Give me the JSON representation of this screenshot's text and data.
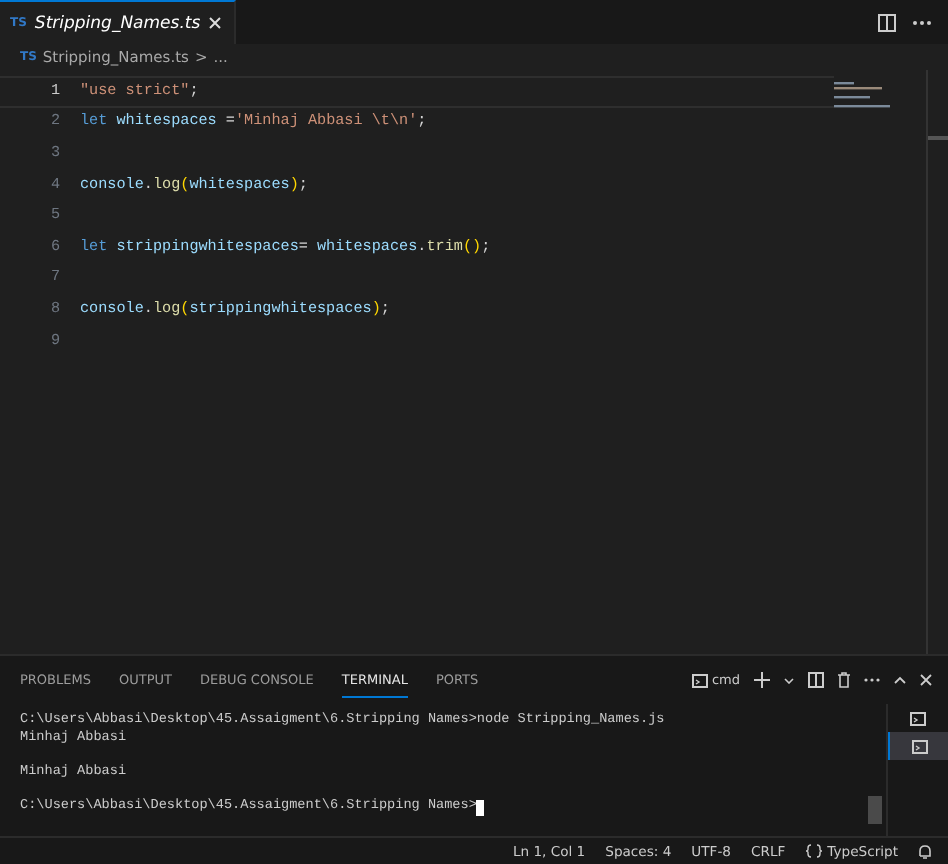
{
  "tab": {
    "icon": "TS",
    "title": "Stripping_Names.ts",
    "selected": true
  },
  "breadcrumb": {
    "icon": "TS",
    "file": "Stripping_Names.ts",
    "separator": ">",
    "more": "..."
  },
  "editor": {
    "lines": [
      {
        "number": "1",
        "current": true,
        "tokens": [
          {
            "text": "\"use strict\"",
            "kind": "string"
          },
          {
            "text": ";",
            "kind": "plain"
          }
        ]
      },
      {
        "number": "2",
        "tokens": [
          {
            "text": "let ",
            "kind": "keyword"
          },
          {
            "text": "whitespaces",
            "kind": "variable"
          },
          {
            "text": " =",
            "kind": "plain"
          },
          {
            "text": "'Minhaj Abbasi \\t\\n'",
            "kind": "string"
          },
          {
            "text": ";",
            "kind": "plain"
          }
        ]
      },
      {
        "number": "3"
      },
      {
        "number": "4",
        "tokens": [
          {
            "text": "console",
            "kind": "variable"
          },
          {
            "text": ".",
            "kind": "plain"
          },
          {
            "text": "log",
            "kind": "function"
          },
          {
            "text": "(",
            "kind": "bracket"
          },
          {
            "text": "whitespaces",
            "kind": "variable"
          },
          {
            "text": ")",
            "kind": "bracket"
          },
          {
            "text": ";",
            "kind": "plain"
          }
        ]
      },
      {
        "number": "5"
      },
      {
        "number": "6",
        "tokens": [
          {
            "text": "let ",
            "kind": "keyword"
          },
          {
            "text": "strippingwhitespaces",
            "kind": "variable"
          },
          {
            "text": "= ",
            "kind": "plain"
          },
          {
            "text": "whitespaces",
            "kind": "variable"
          },
          {
            "text": ".",
            "kind": "plain"
          },
          {
            "text": "trim",
            "kind": "function"
          },
          {
            "text": "()",
            "kind": "bracket"
          },
          {
            "text": ";",
            "kind": "plain"
          }
        ]
      },
      {
        "number": "7"
      },
      {
        "number": "8",
        "tokens": [
          {
            "text": "console",
            "kind": "variable"
          },
          {
            "text": ".",
            "kind": "plain"
          },
          {
            "text": "log",
            "kind": "function"
          },
          {
            "text": "(",
            "kind": "bracket"
          },
          {
            "text": "strippingwhitespaces",
            "kind": "variable"
          },
          {
            "text": ")",
            "kind": "bracket"
          },
          {
            "text": ";",
            "kind": "plain"
          }
        ]
      },
      {
        "number": "9"
      }
    ]
  },
  "panel": {
    "tabs": [
      {
        "label": "PROBLEMS",
        "selected": false
      },
      {
        "label": "OUTPUT",
        "selected": false
      },
      {
        "label": "DEBUG CONSOLE",
        "selected": false
      },
      {
        "label": "TERMINAL",
        "selected": true
      },
      {
        "label": "PORTS",
        "selected": false
      }
    ],
    "shell": "cmd",
    "terminals": [
      {
        "selected": false
      },
      {
        "selected": true
      }
    ],
    "cursor": true,
    "blocks": [
      [
        "C:\\Users\\Abbasi\\Desktop\\45.Assaigment\\6.Stripping Names>node Stripping_Names.js",
        "Minhaj Abbasi"
      ],
      [
        "Minhaj Abbasi"
      ],
      [
        "C:\\Users\\Abbasi\\Desktop\\45.Assaigment\\6.Stripping Names>"
      ]
    ]
  },
  "status_bar": {
    "items": [
      "Ln 1, Col 1",
      "Spaces: 4",
      "UTF-8",
      "CRLF"
    ],
    "language": "TypeScript"
  }
}
